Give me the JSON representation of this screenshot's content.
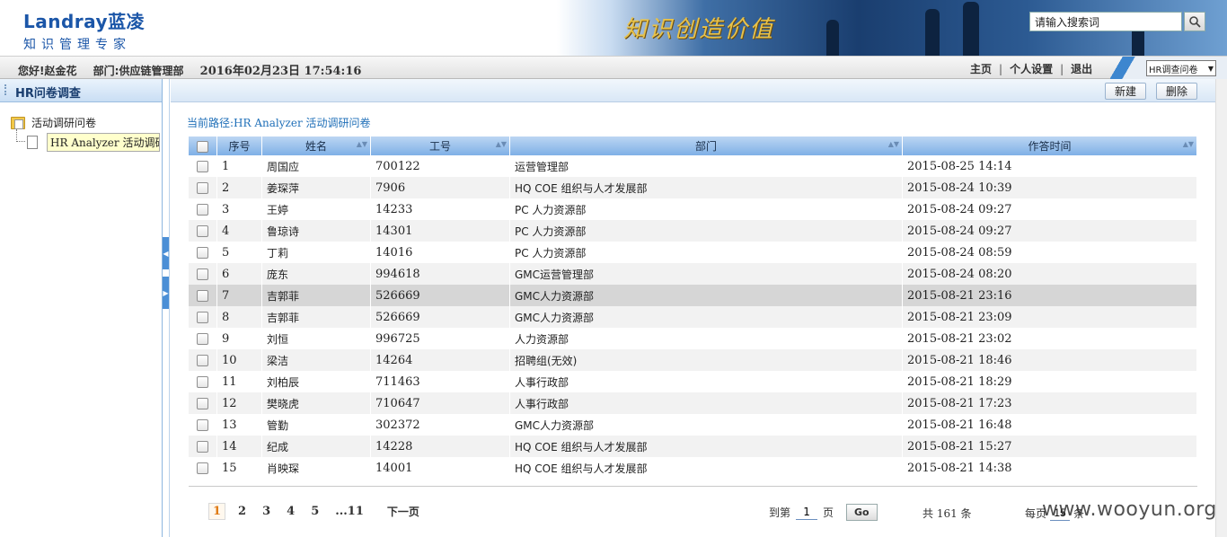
{
  "header": {
    "logo_en": "Landray",
    "logo_cn": "蓝凌",
    "logo_sub": "知识管理专家",
    "slogan": "知识创造价值",
    "search_placeholder": "请输入搜索词"
  },
  "infobar": {
    "greeting": "您好!赵金花",
    "department": "部门:供应链管理部",
    "datetime": "2016年02月23日 17:54:16",
    "links": [
      "主页",
      "个人设置",
      "退出"
    ],
    "select_value": "HR调查问卷"
  },
  "sidebar": {
    "title": "HR问卷调查",
    "root_label": "活动调研问卷",
    "child_label": "HR Analyzer 活动调研问卷"
  },
  "toolbar": {
    "new_label": "新建",
    "delete_label": "删除"
  },
  "breadcrumb": "当前路径:HR Analyzer 活动调研问卷",
  "table": {
    "columns": [
      "序号",
      "姓名",
      "工号",
      "部门",
      "作答时间"
    ],
    "rows": [
      [
        "1",
        "周国应",
        "700122",
        "运营管理部",
        "2015-08-25 14:14"
      ],
      [
        "2",
        "姜琛萍",
        "7906",
        "HQ COE 组织与人才发展部",
        "2015-08-24 10:39"
      ],
      [
        "3",
        "王婷",
        "14233",
        "PC 人力资源部",
        "2015-08-24 09:27"
      ],
      [
        "4",
        "鲁琼诗",
        "14301",
        "PC 人力资源部",
        "2015-08-24 09:27"
      ],
      [
        "5",
        "丁莉",
        "14016",
        "PC 人力资源部",
        "2015-08-24 08:59"
      ],
      [
        "6",
        "庞东",
        "994618",
        "GMC运营管理部",
        "2015-08-24 08:20"
      ],
      [
        "7",
        "吉郭菲",
        "526669",
        "GMC人力资源部",
        "2015-08-21 23:16"
      ],
      [
        "8",
        "吉郭菲",
        "526669",
        "GMC人力资源部",
        "2015-08-21 23:09"
      ],
      [
        "9",
        "刘恒",
        "996725",
        "人力资源部",
        "2015-08-21 23:02"
      ],
      [
        "10",
        "梁洁",
        "14264",
        "招聘组(无效)",
        "2015-08-21 18:46"
      ],
      [
        "11",
        "刘柏辰",
        "711463",
        "人事行政部",
        "2015-08-21 18:29"
      ],
      [
        "12",
        "樊晓虎",
        "710647",
        "人事行政部",
        "2015-08-21 17:23"
      ],
      [
        "13",
        "管勤",
        "302372",
        "GMC人力资源部",
        "2015-08-21 16:48"
      ],
      [
        "14",
        "纪成",
        "14228",
        "HQ COE 组织与人才发展部",
        "2015-08-21 15:27"
      ],
      [
        "15",
        "肖映琛",
        "14001",
        "HQ COE 组织与人才发展部",
        "2015-08-21 14:38"
      ]
    ],
    "highlight_row": 7
  },
  "pager": {
    "pages": [
      "1",
      "2",
      "3",
      "4",
      "5",
      "...11"
    ],
    "current": "1",
    "next_label": "下一页",
    "goto_prefix": "到第",
    "goto_value": "1",
    "goto_suffix": "页",
    "go_label": "Go",
    "total": "共 161 条",
    "perpage_prefix": "每页",
    "perpage_value": "15",
    "perpage_suffix": "条"
  },
  "watermark": "www.wooyun.org"
}
